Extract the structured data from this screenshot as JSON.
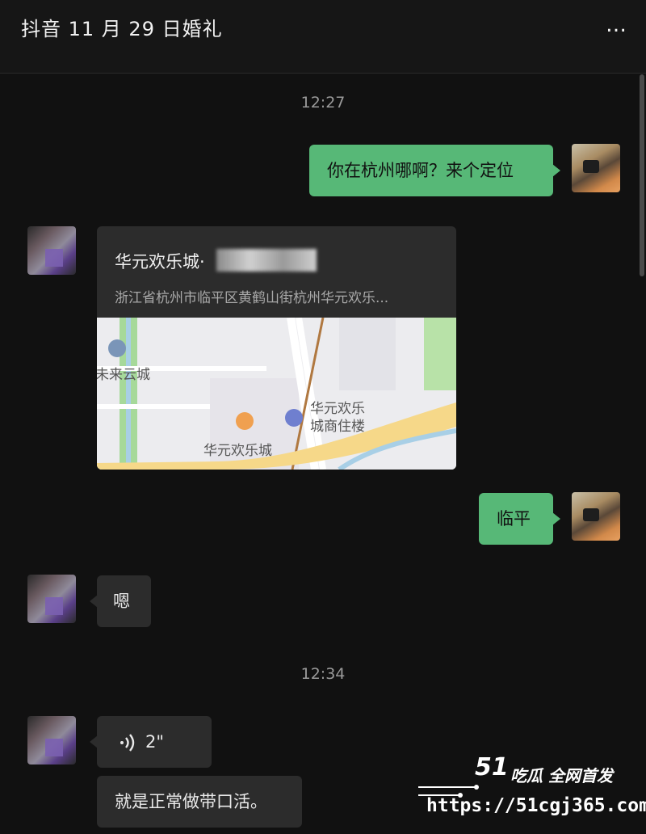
{
  "header": {
    "title": "抖音 11 月 29 日婚礼",
    "more_icon": "…"
  },
  "colors": {
    "background": "#111111",
    "self_bubble": "#57b877",
    "other_bubble": "#2c2c2c"
  },
  "messages": {
    "time1": "12:27",
    "m1_text": "你在杭州哪啊？来个定位",
    "loc_name": "华元欢乐城·",
    "loc_address": "浙江省杭州市临平区黄鹤山街杭州华元欢乐...",
    "map_label_1": "未来云城",
    "map_label_2": "华元欢乐",
    "map_label_3": "城商住楼",
    "map_label_4": "华元欢乐城",
    "m3_text": "临平",
    "m4_text": "嗯",
    "time2": "12:34",
    "voice_duration": "2\"",
    "m6_text": "就是正常做带口活。"
  },
  "watermark": {
    "brand": "51",
    "slogan": "吃瓜 全网首发",
    "url": "https://51cgj365.com"
  }
}
